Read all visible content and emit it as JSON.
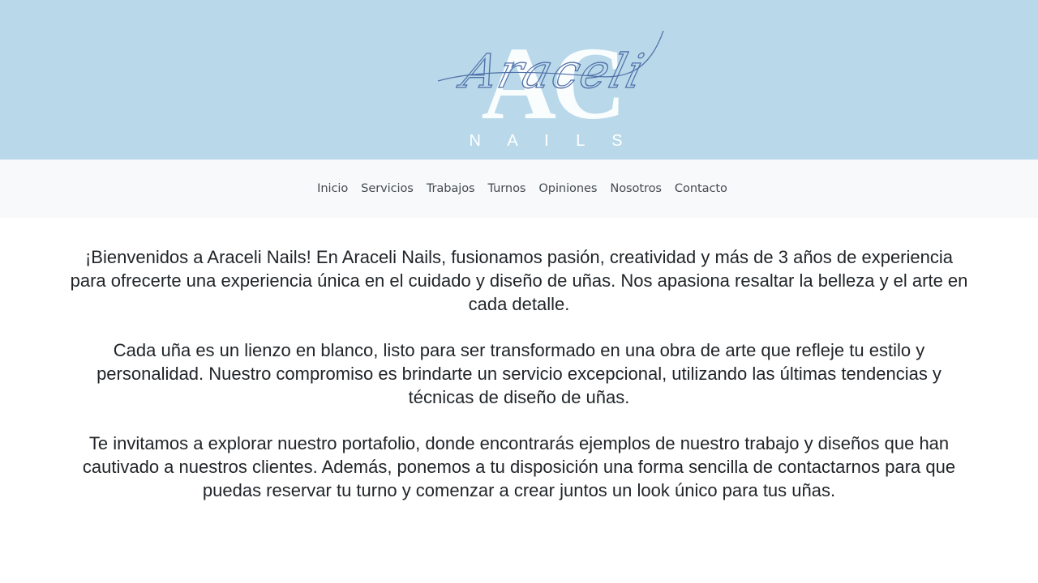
{
  "header": {
    "logo_script": "Araceli",
    "logo_monogram": "AC",
    "logo_subtitle": "N A I L S",
    "colors": {
      "background": "#b9d9ea",
      "monogram": "#ffffff",
      "script": "#4f6fa8"
    }
  },
  "nav": {
    "items": [
      {
        "label": "Inicio"
      },
      {
        "label": "Servicios"
      },
      {
        "label": "Trabajos"
      },
      {
        "label": "Turnos"
      },
      {
        "label": "Opiniones"
      },
      {
        "label": "Nosotros"
      },
      {
        "label": "Contacto"
      }
    ]
  },
  "main": {
    "paragraphs": [
      "¡Bienvenidos a Araceli Nails! En Araceli Nails, fusionamos pasión, creatividad y más de 3 años de experiencia para ofrecerte una experiencia única en el cuidado y diseño de uñas. Nos apasiona resaltar la belleza y el arte en cada detalle.",
      "Cada uña es un lienzo en blanco, listo para ser transformado en una obra de arte que refleje tu estilo y personalidad. Nuestro compromiso es brindarte un servicio excepcional, utilizando las últimas tendencias y técnicas de diseño de uñas.",
      "Te invitamos a explorar nuestro portafolio, donde encontrarás ejemplos de nuestro trabajo y diseños que han cautivado a nuestros clientes. Además, ponemos a tu disposición una forma sencilla de contactarnos para que puedas reservar tu turno y comenzar a crear juntos un look único para tus uñas."
    ]
  }
}
